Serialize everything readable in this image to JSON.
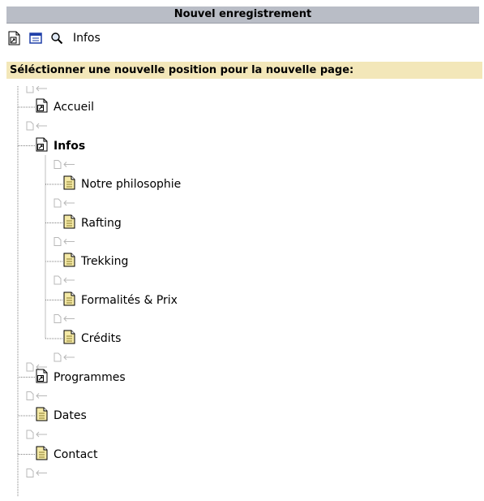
{
  "window": {
    "title": "Nouvel enregistrement"
  },
  "toolbar": {
    "icons": [
      "page-shortcut-icon",
      "list-icon",
      "zoom-icon"
    ],
    "current_page": "Infos"
  },
  "section": {
    "heading": "Séléctionner une nouvelle position pour la nouvelle page:"
  },
  "tree": {
    "nodes": [
      {
        "label": "Accueil",
        "type": "shortcut",
        "level": 0,
        "bold": false
      },
      {
        "label": "Infos",
        "type": "shortcut",
        "level": 0,
        "bold": true
      },
      {
        "label": "Notre philosophie",
        "type": "page",
        "level": 1,
        "bold": false
      },
      {
        "label": "Rafting",
        "type": "page",
        "level": 1,
        "bold": false
      },
      {
        "label": "Trekking",
        "type": "page",
        "level": 1,
        "bold": false
      },
      {
        "label": "Formalités & Prix",
        "type": "page",
        "level": 1,
        "bold": false
      },
      {
        "label": "Crédits",
        "type": "page",
        "level": 1,
        "bold": false
      },
      {
        "label": "Programmes",
        "type": "shortcut",
        "level": 0,
        "bold": false
      },
      {
        "label": "Dates",
        "type": "page",
        "level": 0,
        "bold": false
      },
      {
        "label": "Contact",
        "type": "page",
        "level": 0,
        "bold": false
      }
    ]
  },
  "colors": {
    "titlebar": "#b9bdc6",
    "heading_bg": "#f3e7b9",
    "page_icon_fill": "#f4e9a6",
    "tree_line": "#808080",
    "insert_marker": "#b8b8b8"
  }
}
